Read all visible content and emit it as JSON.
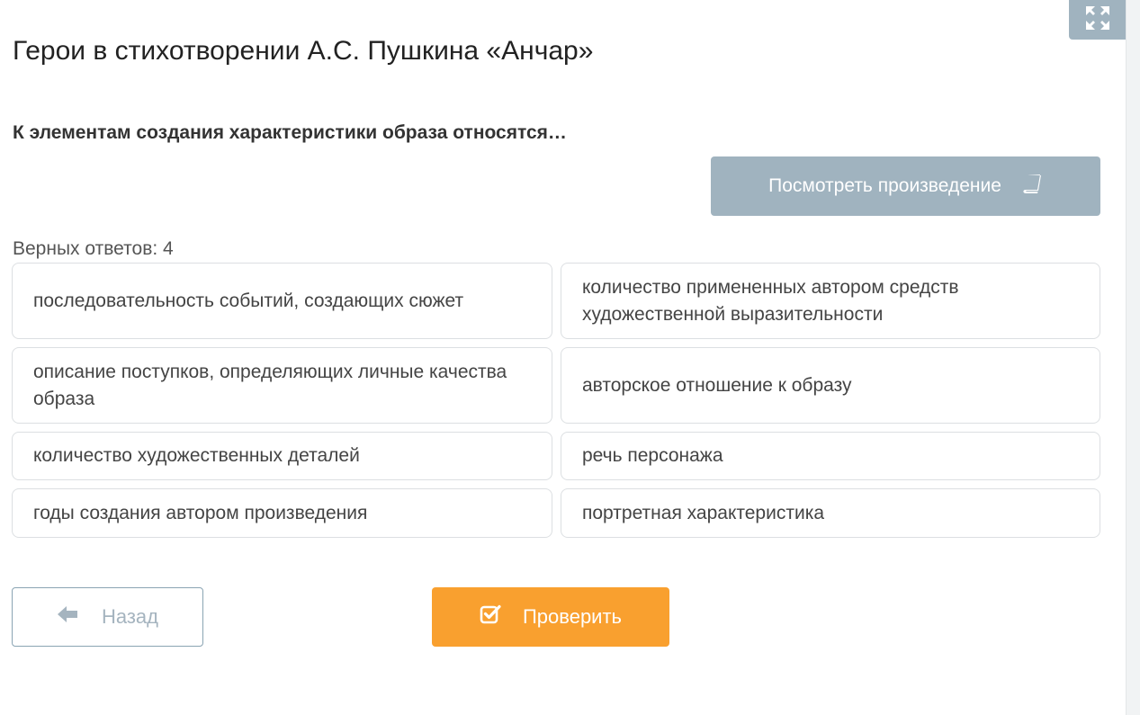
{
  "header": {
    "title": "Герои в стихотворении А.С. Пушкина «Анчар»",
    "expand_icon": "expand-arrows-icon"
  },
  "question": {
    "text": "К элементам создания характеристики образа относятся…"
  },
  "view_work": {
    "label": "Посмотреть произведение",
    "icon": "book-icon"
  },
  "correct_answers": {
    "text": "Верных ответов: 4"
  },
  "options": [
    "последовательность событий, создающих сюжет",
    "количество примененных автором средств художественной выразительности",
    "описание поступков, определяющих личные качества образа",
    "авторское отношение к образу",
    "количество художественных деталей",
    "речь персонажа",
    "годы создания автором произведения",
    "портретная характеристика"
  ],
  "navigation": {
    "back_label": "Назад",
    "back_icon": "arrow-left-icon",
    "check_label": "Проверить",
    "check_icon": "check-square-icon"
  },
  "colors": {
    "primary_gray": "#a0b3bf",
    "accent_orange": "#f9a02f",
    "option_border": "#dcdfe2"
  }
}
